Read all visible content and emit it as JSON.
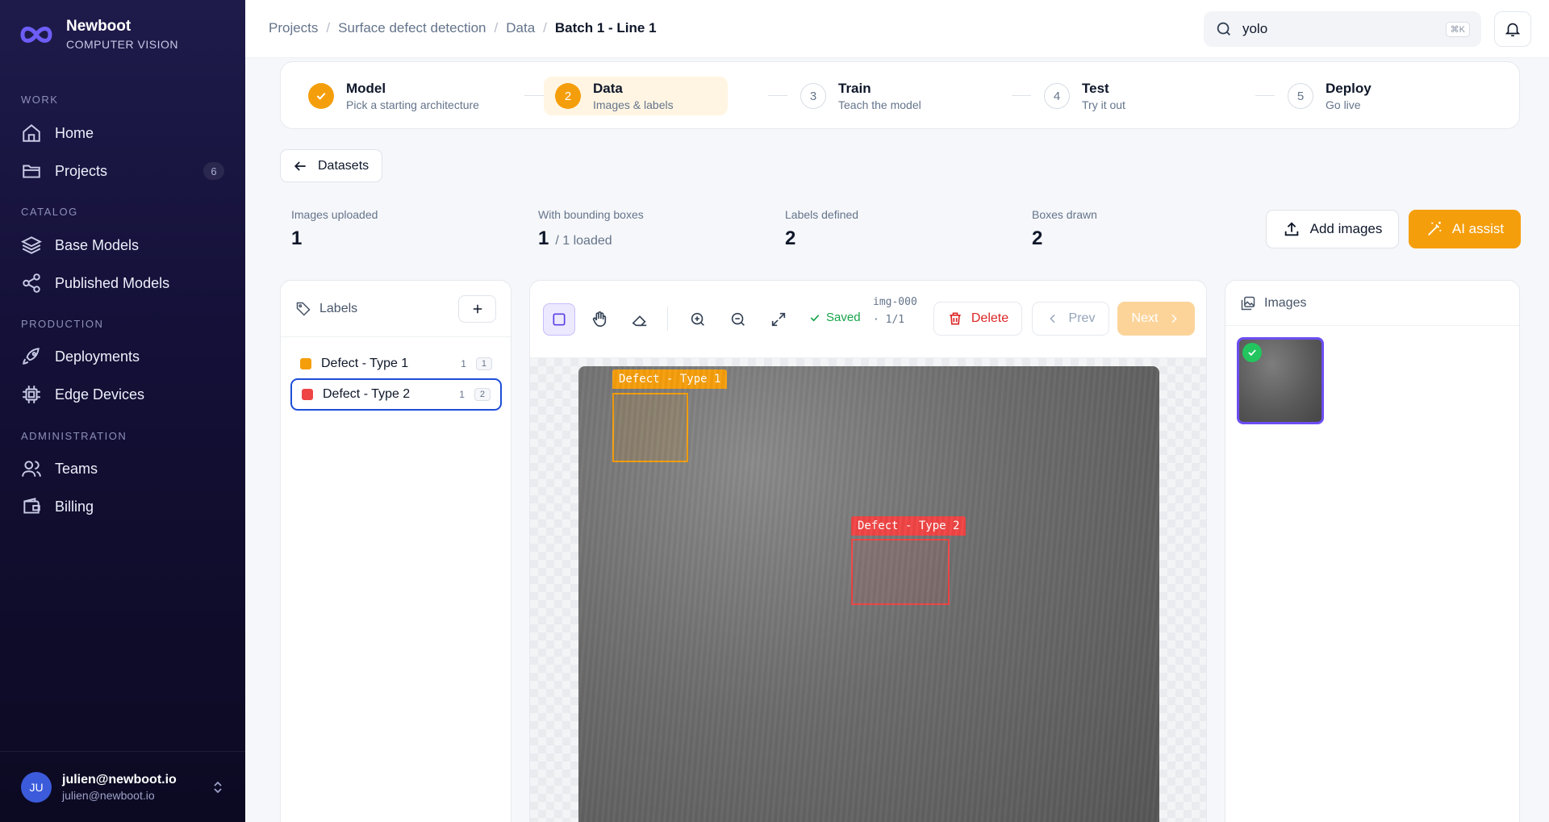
{
  "brand": {
    "name": "Newboot",
    "subtitle": "COMPUTER VISION"
  },
  "sidebar": {
    "sections": [
      {
        "title": "WORK",
        "items": [
          {
            "label": "Home",
            "icon": "home-icon"
          },
          {
            "label": "Projects",
            "icon": "folder-icon",
            "badge": "6"
          }
        ]
      },
      {
        "title": "CATALOG",
        "items": [
          {
            "label": "Base Models",
            "icon": "layers-icon"
          },
          {
            "label": "Published Models",
            "icon": "share-icon"
          }
        ]
      },
      {
        "title": "PRODUCTION",
        "items": [
          {
            "label": "Deployments",
            "icon": "rocket-icon"
          },
          {
            "label": "Edge Devices",
            "icon": "chip-icon"
          }
        ]
      },
      {
        "title": "ADMINISTRATION",
        "items": [
          {
            "label": "Teams",
            "icon": "users-icon"
          },
          {
            "label": "Billing",
            "icon": "wallet-icon"
          }
        ]
      }
    ],
    "user": {
      "initials": "JU",
      "name": "julien@newboot.io",
      "email": "julien@newboot.io"
    }
  },
  "breadcrumb": [
    "Projects",
    "Surface defect detection",
    "Data",
    "Batch 1 - Line 1"
  ],
  "search": {
    "value": "yolo",
    "shortcut": "⌘K"
  },
  "stepper": [
    {
      "number": "1",
      "title": "Model",
      "desc": "Pick a starting architecture",
      "state": "done"
    },
    {
      "number": "2",
      "title": "Data",
      "desc": "Images & labels",
      "state": "active"
    },
    {
      "number": "3",
      "title": "Train",
      "desc": "Teach the model",
      "state": "todo"
    },
    {
      "number": "4",
      "title": "Test",
      "desc": "Try it out",
      "state": "todo"
    },
    {
      "number": "5",
      "title": "Deploy",
      "desc": "Go live",
      "state": "todo"
    }
  ],
  "back_button": "Datasets",
  "stats": [
    {
      "label": "Images uploaded",
      "value": "1",
      "suffix": ""
    },
    {
      "label": "With bounding boxes",
      "value": "1",
      "suffix": "/ 1 loaded"
    },
    {
      "label": "Labels defined",
      "value": "2",
      "suffix": ""
    },
    {
      "label": "Boxes drawn",
      "value": "2",
      "suffix": ""
    }
  ],
  "actions": {
    "add_images": "Add images",
    "ai_assist": "AI assist"
  },
  "labels_panel": {
    "title": "Labels",
    "labels": [
      {
        "name": "Defect - Type 1",
        "count": "1",
        "key": "1",
        "color": "#f59e0b",
        "selected": false
      },
      {
        "name": "Defect - Type 2",
        "count": "1",
        "key": "2",
        "color": "#ef4444",
        "selected": true
      }
    ]
  },
  "canvas": {
    "status": "Saved",
    "image_id": "img-000 · 1/1",
    "delete": "Delete",
    "prev": "Prev",
    "next": "Next",
    "boxes": [
      {
        "label": "Defect - Type 1",
        "color": "#f59e0b"
      },
      {
        "label": "Defect - Type 2",
        "color": "#ef4444"
      }
    ]
  },
  "images_panel": {
    "title": "Images"
  }
}
